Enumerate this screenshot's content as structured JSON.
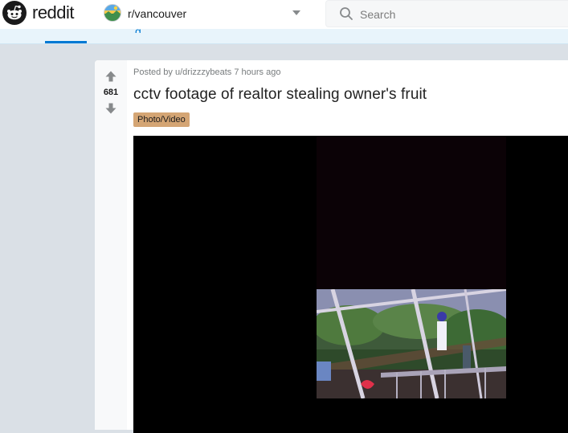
{
  "header": {
    "brand": "reddit",
    "community": "r/vancouver",
    "search_placeholder": "Search"
  },
  "tabs": {
    "partial_label": "g"
  },
  "post": {
    "score": "681",
    "posted_by_prefix": "Posted by",
    "author": "u/drizzzybeats",
    "time": "7 hours ago",
    "title": "cctv footage of realtor stealing owner's fruit",
    "flair": "Photo/Video"
  },
  "colors": {
    "page_bg": "#dae0e6",
    "accent": "#0079d3",
    "flair_bg": "#d4a574",
    "brand_orange": "#ff4500"
  },
  "icons": [
    "reddit-logo-icon",
    "community-icon",
    "chevron-down-icon",
    "search-icon",
    "upvote-icon",
    "downvote-icon"
  ]
}
